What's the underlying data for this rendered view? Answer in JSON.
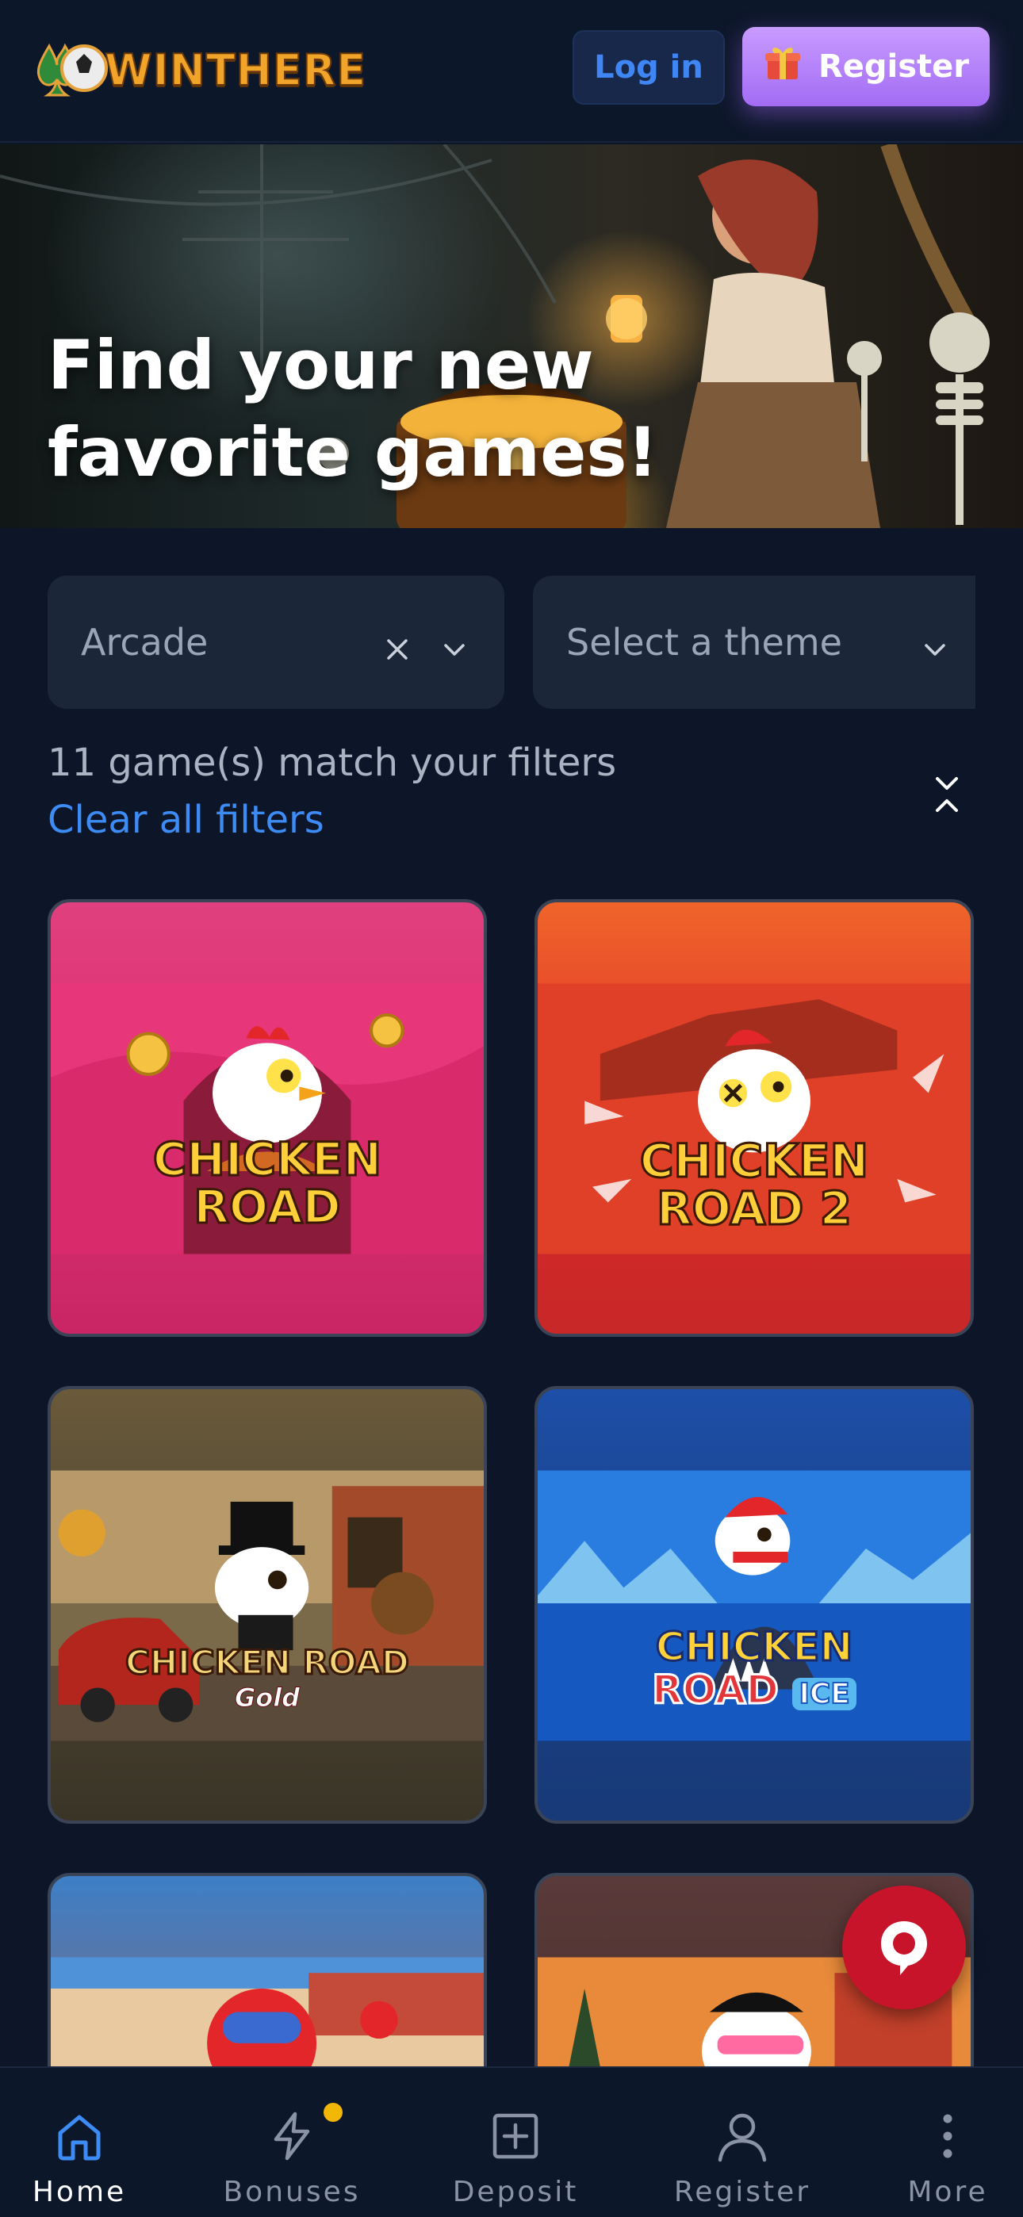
{
  "header": {
    "brand": "WINTHERE",
    "login_label": "Log in",
    "register_label": "Register"
  },
  "hero": {
    "title": "Find your new favorite games!"
  },
  "filters": {
    "category_value": "Arcade",
    "theme_placeholder": "Select a theme",
    "match_text": "11 game(s) match your filters",
    "clear_all_label": "Clear all filters"
  },
  "games": [
    {
      "title_line1": "CHICKEN",
      "title_line2": "ROAD"
    },
    {
      "title_line1": "CHICKEN",
      "title_line2": "ROAD 2"
    },
    {
      "title_line1": "CHICKEN ROAD",
      "title_line2": "Gold"
    },
    {
      "title_line1": "CHICKEN",
      "title_line2": "ROAD",
      "tag": "ICE"
    },
    {},
    {}
  ],
  "bottom_nav": {
    "items": [
      {
        "label": "Home",
        "icon": "home-icon",
        "active": true
      },
      {
        "label": "Bonuses",
        "icon": "lightning-icon",
        "badge": true
      },
      {
        "label": "Deposit",
        "icon": "plus-square-icon"
      },
      {
        "label": "Register",
        "icon": "user-icon"
      },
      {
        "label": "More",
        "icon": "dots-vertical-icon"
      }
    ]
  },
  "colors": {
    "background": "#0c1628",
    "accent_blue": "#3d8bf5",
    "register_purple": "#a36cf4",
    "chat_red": "#c8142a",
    "badge_yellow": "#f2b705"
  }
}
